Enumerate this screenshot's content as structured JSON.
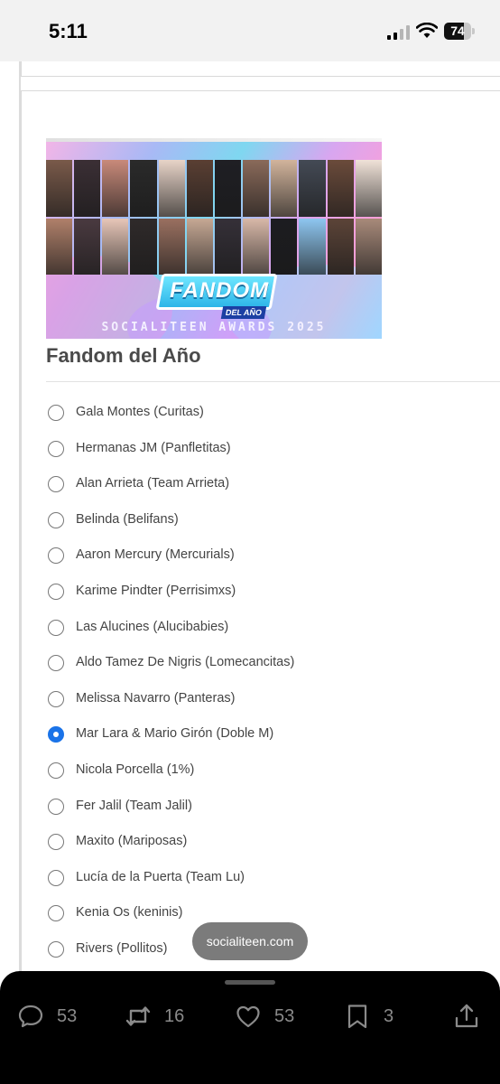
{
  "status": {
    "time": "5:11",
    "battery": "74",
    "battery_level": 0.74,
    "icons": [
      "signal-icon",
      "wifi-icon",
      "battery-icon"
    ]
  },
  "banner": {
    "badge_title": "FANDOM",
    "badge_subtitle": "DEL AÑO",
    "footer": "SOCIALITEEN AWARDS 2025"
  },
  "poll": {
    "title": "Fandom del Año",
    "selected_index": 9,
    "options": [
      "Gala Montes (Curitas)",
      "Hermanas JM (Panfletitas)",
      "Alan Arrieta (Team Arrieta)",
      "Belinda (Belifans)",
      "Aaron Mercury (Mercurials)",
      "Karime Pindter (Perrisimxs)",
      "Las Alucines (Alucibabies)",
      "Aldo Tamez De Nigris (Lomecancitas)",
      "Melissa Navarro (Panteras)",
      "Mar Lara & Mario Girón (Doble M)",
      "Nicola Porcella (1%)",
      "Fer Jalil (Team Jalil)",
      "Maxito (Mariposas)",
      "Lucía de la Puerta (Team Lu)",
      "Kenia Os (keninis)",
      "Rivers (Pollitos)"
    ]
  },
  "toast": {
    "text": "socialiteen.com"
  },
  "actions": {
    "reply_count": "53",
    "repost_count": "16",
    "like_count": "53",
    "bookmark_count": "3",
    "icons": [
      "reply-icon",
      "repost-icon",
      "like-icon",
      "bookmark-icon",
      "share-icon"
    ]
  }
}
